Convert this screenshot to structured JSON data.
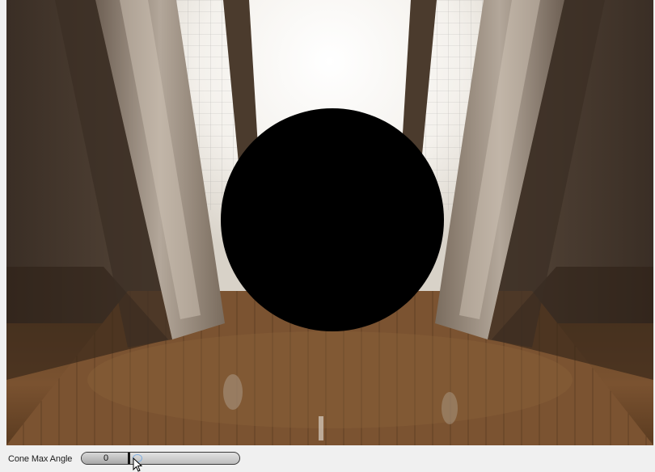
{
  "viewport": {
    "description_icon": "environment-render-viewport",
    "sphere_color": "#000000"
  },
  "controls": {
    "cone_max_angle": {
      "label": "Cone Max Angle",
      "value": "0",
      "fill_fraction": 0.3
    }
  },
  "cursor": {
    "icon": "mouse-pointer-icon"
  }
}
